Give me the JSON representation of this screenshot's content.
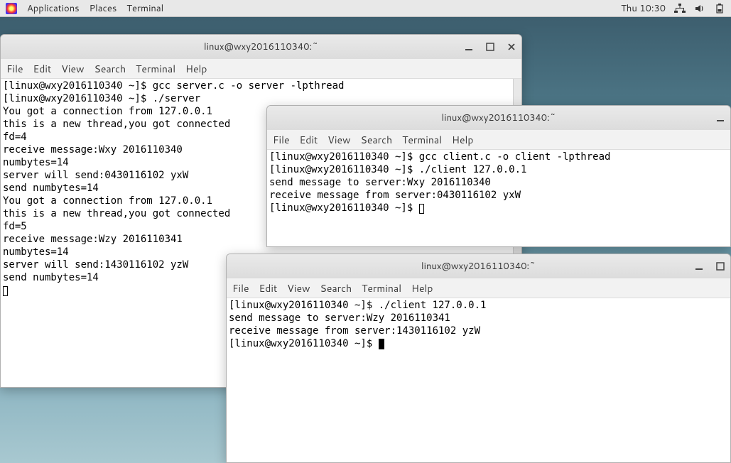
{
  "topbar": {
    "applications": "Applications",
    "places": "Places",
    "terminal": "Terminal",
    "datetime": "Thu 10:30"
  },
  "window1": {
    "title": "linux@wxy2016110340:~",
    "menus": {
      "file": "File",
      "edit": "Edit",
      "view": "View",
      "search": "Search",
      "terminal": "Terminal",
      "help": "Help"
    },
    "content": "[linux@wxy2016110340 ~]$ gcc server.c -o server -lpthread\n[linux@wxy2016110340 ~]$ ./server\nYou got a connection from 127.0.0.1\nthis is a new thread,you got connected\nfd=4\nreceive message:Wxy 2016110340\nnumbytes=14\nserver will send:0430116102 yxW\nsend numbytes=14\nYou got a connection from 127.0.0.1\nthis is a new thread,you got connected\nfd=5\nreceive message:Wzy 2016110341\nnumbytes=14\nserver will send:1430116102 yzW\nsend numbytes=14\n"
  },
  "window2": {
    "title": "linux@wxy2016110340:~",
    "menus": {
      "file": "File",
      "edit": "Edit",
      "view": "View",
      "search": "Search",
      "terminal": "Terminal",
      "help": "Help"
    },
    "content": "[linux@wxy2016110340 ~]$ gcc client.c -o client -lpthread\n[linux@wxy2016110340 ~]$ ./client 127.0.0.1\nsend message to server:Wxy 2016110340\nreceive message from server:0430116102 yxW\n[linux@wxy2016110340 ~]$ "
  },
  "window3": {
    "title": "linux@wxy2016110340:~",
    "menus": {
      "file": "File",
      "edit": "Edit",
      "view": "View",
      "search": "Search",
      "terminal": "Terminal",
      "help": "Help"
    },
    "content": "[linux@wxy2016110340 ~]$ ./client 127.0.0.1\nsend message to server:Wzy 2016110341\nreceive message from server:1430116102 yzW\n[linux@wxy2016110340 ~]$ "
  }
}
